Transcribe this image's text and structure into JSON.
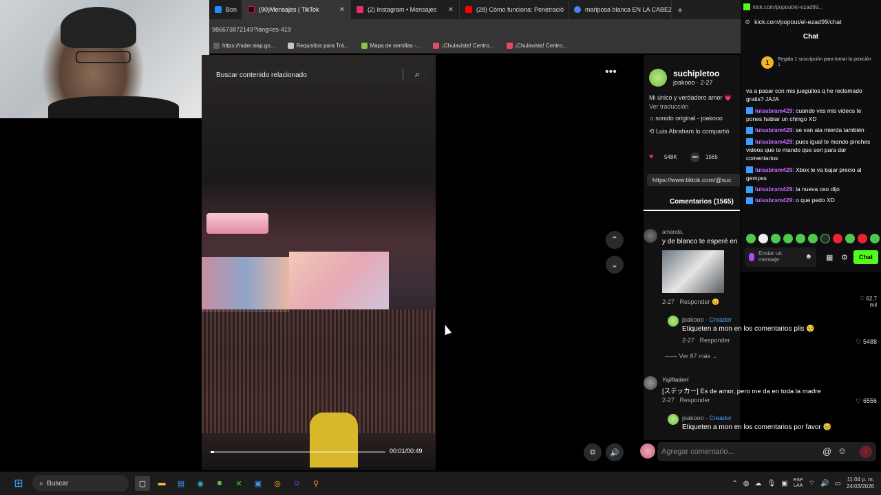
{
  "tabs": [
    {
      "label": "Bon",
      "color": "#1e90ff"
    },
    {
      "label": "(90)Mensajes | TikTok",
      "color": "#111111",
      "active": true
    },
    {
      "label": "(2) Instagram • Mensajes",
      "color": "#e1306c"
    },
    {
      "label": "(28) Cómo funciona: Penetració",
      "color": "#ff0000"
    },
    {
      "label": "mariposa blanca EN LA CABEZ",
      "color": "#4285f4"
    }
  ],
  "url": "986673872149?lang=es-419",
  "bookmarks": [
    {
      "label": "https://nube.siap.go...",
      "color": "#5f6368"
    },
    {
      "label": "Requisitos para Trá...",
      "color": "#c6c6c6"
    },
    {
      "label": "Mapa de semillas -...",
      "color": "#8bc34a"
    },
    {
      "label": "¡Chulavista! Centro...",
      "color": "#e04b6a"
    },
    {
      "label": "¡Chulavista! Centro...",
      "color": "#e04b6a"
    }
  ],
  "video": {
    "search_placeholder": "Buscar contenido relacionado",
    "timecode": "00:01/00:49",
    "progress": 0.02
  },
  "post": {
    "username": "suchipletoo",
    "handle_date": "joakooo · 2-27",
    "caption": "Mi único y verdadero amor 💗",
    "translate": "Ver traducción",
    "sound": "sonido original - joakooo",
    "shared": "Luis Abraham lo compartió",
    "likes": "548K",
    "comments_count": "1565",
    "link": "https://www.tiktok.com/@suc",
    "comments_tab": "Comentarios (1565)"
  },
  "comments": [
    {
      "name": "amanda,",
      "text": "y de blanco te esperé en",
      "date": "2-27",
      "reply": "Responder",
      "likes": "62,7 mil",
      "reply_user": "joakooo",
      "creator": "Creador",
      "reply_text": "Etiqueten a mon en los comentarios plis 🥺",
      "reply_date": "2-27",
      "reply_likes": "5488",
      "more": "Ver 87 más"
    },
    {
      "name": "Yajiltadori",
      "text": "[ステッカー] Es de amor, pero me da en toda la madre",
      "date": "2-27",
      "reply": "Responder",
      "likes": "6556",
      "reply_user": "joakooo",
      "creator": "Creador",
      "reply_text": "Etiqueten a mon en los comentarios por favor 🥺"
    }
  ],
  "add_comment_placeholder": "Agregar comentario...",
  "kick": {
    "top": "kick.com/popout/el-ezad99...",
    "url": "kick.com/popout/el-ezad99/chat",
    "title": "Chat",
    "gift_text": "Regala 1 suscripción para tomar la posición 1",
    "first_msg": "va a pasar con mis jueguitos q he reclamado gratis? JAJA",
    "messages": [
      {
        "user": "luisabram429",
        "text": "cuando ves mis videos te pones hablar un chingo XD"
      },
      {
        "user": "luisabram429",
        "text": "se van ala mierda también"
      },
      {
        "user": "luisabram429",
        "text": "pues igual te mando pinches videos que te mando que son para dar comentarios"
      },
      {
        "user": "luisabram429",
        "text": "Xbox le va bajar precio al gempss"
      },
      {
        "user": "luisabram429",
        "text": "la nueva ceo dijo"
      },
      {
        "user": "luisabram429",
        "text": "o que pedo XD"
      }
    ],
    "input_placeholder": "Enviar un mensaje",
    "send_label": "Chat"
  },
  "taskbar": {
    "search": "Buscar",
    "lang": "ESP",
    "lang2": "LAA",
    "time": "11:04 p. m.",
    "date": "24/03/2026"
  }
}
